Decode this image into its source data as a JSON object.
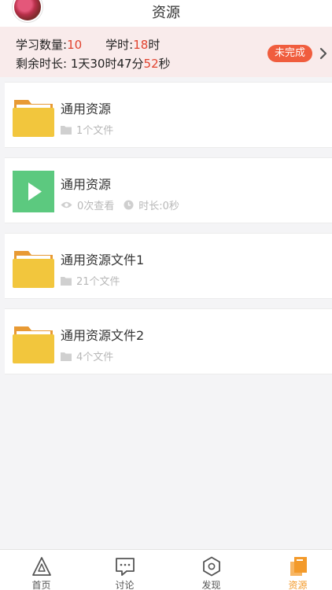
{
  "header": {
    "title": "资源"
  },
  "study": {
    "count_label": "学习数量:",
    "count_value": "10",
    "hours_label": "学时:",
    "hours_value": "18",
    "hours_unit": "时",
    "remaining_label": "剩余时长: ",
    "remaining_text": "1天30时47分",
    "remaining_seconds": "52",
    "seconds_unit": "秒",
    "status_label": "未完成"
  },
  "items": [
    {
      "type": "folder",
      "name": "通用资源",
      "meta1": "1个文件",
      "folder_color": "#f2c63d"
    },
    {
      "type": "video",
      "name": "通用资源",
      "meta1": "0次查看",
      "meta2": "时长:0秒",
      "video_color": "#5cc97f"
    },
    {
      "type": "folder",
      "name": "通用资源文件1",
      "meta1": "21个文件",
      "folder_color": "#f2c63d"
    },
    {
      "type": "folder",
      "name": "通用资源文件2",
      "meta1": "4个文件",
      "folder_color": "#f2c63d"
    }
  ],
  "tabs": [
    {
      "label": "首页",
      "icon": "home-triangle-icon"
    },
    {
      "label": "讨论",
      "icon": "chat-bubble-icon"
    },
    {
      "label": "发现",
      "icon": "hexagon-compass-icon"
    },
    {
      "label": "资源",
      "icon": "book-stack-icon",
      "active": true
    }
  ],
  "colors": {
    "accent_red": "#e1432f",
    "badge": "#f05d3e",
    "tab_active": "#f39a2a",
    "banner_bg": "#f9ebeb"
  }
}
